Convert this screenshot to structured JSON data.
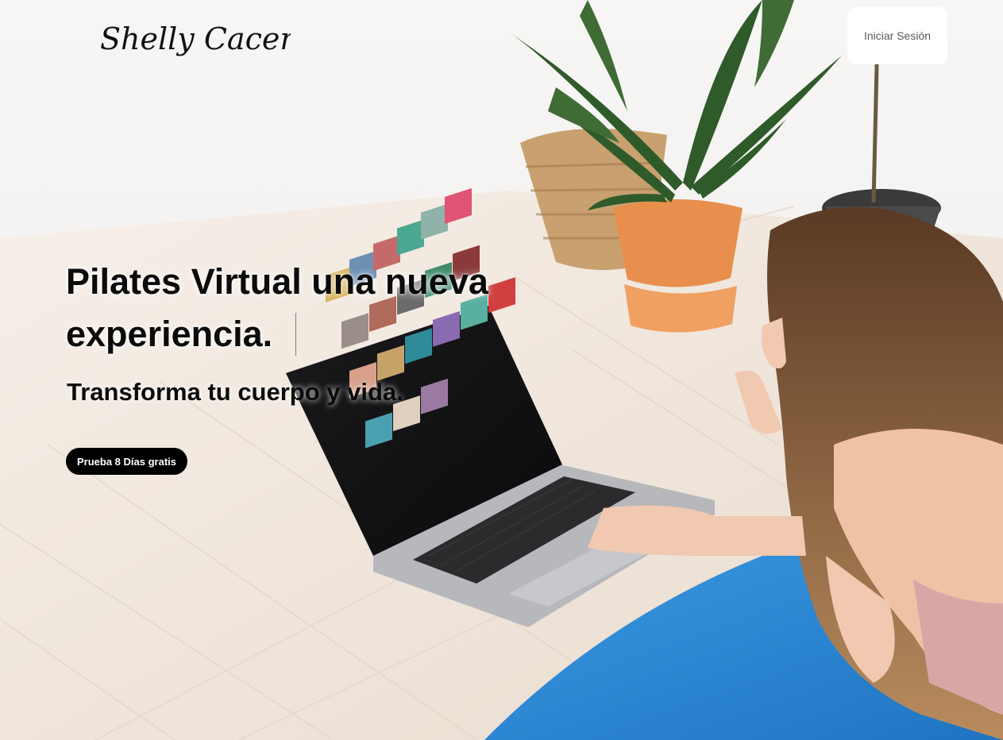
{
  "header": {
    "logo_text": "Shelly Caceres",
    "login_label": "Iniciar Sesión"
  },
  "hero": {
    "headline": "Pilates Virtual una nueva experiencia.",
    "subheadline": "Transforma tu cuerpo y vida.",
    "cta_label": "Prueba 8 Días gratis"
  },
  "colors": {
    "cta_background": "#000000",
    "cta_text": "#ffffff",
    "login_background": "#ffffff",
    "mat_blue": "#2f8ad6"
  }
}
